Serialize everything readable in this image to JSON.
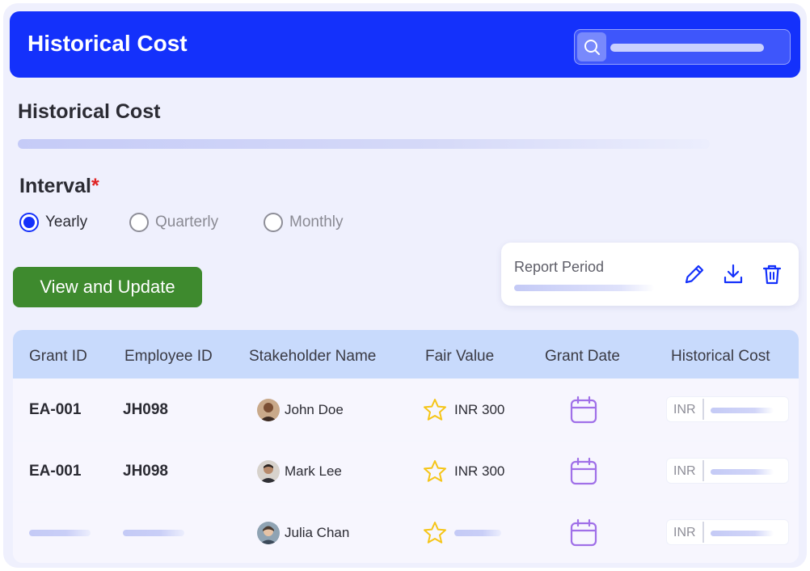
{
  "header": {
    "title": "Historical Cost",
    "search": {
      "placeholder": ""
    }
  },
  "section": {
    "title": "Historical Cost"
  },
  "interval": {
    "label": "Interval",
    "required_mark": "*",
    "options": [
      {
        "label": "Yearly",
        "selected": true
      },
      {
        "label": "Quarterly",
        "selected": false
      },
      {
        "label": "Monthly",
        "selected": false
      }
    ]
  },
  "actions": {
    "view_update_label": "View and Update"
  },
  "report_period": {
    "label": "Report Period",
    "icons": [
      "pencil-icon",
      "download-icon",
      "trash-icon"
    ]
  },
  "table": {
    "columns": [
      "Grant ID",
      "Employee ID",
      "Stakeholder Name",
      "Fair Value",
      "Grant Date",
      "Historical Cost"
    ],
    "rows": [
      {
        "grant_id": "EA-001",
        "employee_id": "JH098",
        "stakeholder": "John Doe",
        "fair_value": "INR 300",
        "currency": "INR"
      },
      {
        "grant_id": "EA-001",
        "employee_id": "JH098",
        "stakeholder": "Mark Lee",
        "fair_value": "INR 300",
        "currency": "INR"
      },
      {
        "grant_id": "",
        "employee_id": "",
        "stakeholder": "Julia Chan",
        "fair_value": "",
        "currency": "INR"
      }
    ]
  },
  "colors": {
    "brand_blue": "#1431fb",
    "action_green": "#3e8a2e",
    "table_header": "#c8dafc",
    "star_yellow": "#f5c518",
    "calendar_purple": "#a070e8",
    "required_red": "#e02424"
  }
}
